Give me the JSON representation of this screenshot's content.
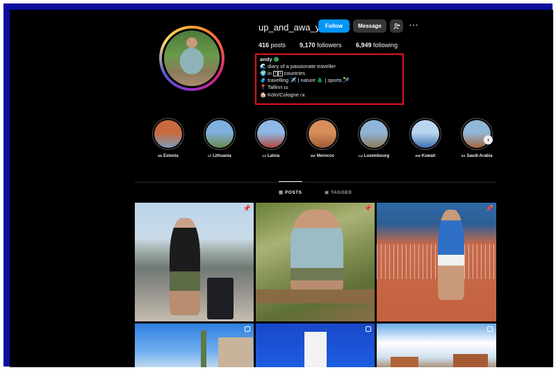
{
  "profile": {
    "username": "up_and_awa_y",
    "follow_label": "Follow",
    "message_label": "Message",
    "posts_count": "416",
    "posts_label": "posts",
    "followers_count": "9,170",
    "followers_label": "followers",
    "following_count": "6,949",
    "following_label": "following"
  },
  "bio": {
    "name": "andy",
    "line1": "diary of a passionate traveller",
    "line2_pre": "in",
    "line2_num": "7",
    "line2_num2": "3",
    "line2_post": "countries",
    "line3": "travelling ✈️ | nature 🌲 | sports 🎾",
    "line4": "Tallinn",
    "line4_flag": "EE",
    "line5": "Köln/Cologne",
    "line5_flag": "DE"
  },
  "highlights": [
    {
      "code": "EE",
      "label": "Estonia",
      "colors": [
        "#c76b3f",
        "#7e9ab8"
      ]
    },
    {
      "code": "LT",
      "label": "Lithuania",
      "colors": [
        "#7fb0de",
        "#6c8a4a"
      ]
    },
    {
      "code": "LV",
      "label": "Latvia",
      "colors": [
        "#8fb8e6",
        "#b0463a"
      ]
    },
    {
      "code": "MA",
      "label": "Morocco",
      "colors": [
        "#d88e5a",
        "#9d5a36"
      ]
    },
    {
      "code": "LU",
      "label": "Luxembourg",
      "colors": [
        "#8fb4d8",
        "#8a7a5a"
      ]
    },
    {
      "code": "KW",
      "label": "Kuwait",
      "colors": [
        "#b9d6f0",
        "#3b6fb0"
      ]
    },
    {
      "code": "SA",
      "label": "Saudi-Arabia",
      "colors": [
        "#8fb8d8",
        "#a8643a"
      ]
    }
  ],
  "tabs": {
    "posts": "POSTS",
    "tagged": "TAGGED"
  },
  "icons": {
    "add_user": "person-add-icon",
    "more": "more-dots-icon",
    "grid": "grid-icon",
    "tag": "tag-icon",
    "pin": "pin-icon",
    "multi": "multiple-photos-icon"
  },
  "colors": {
    "follow_blue": "#0095f6",
    "highlight_red": "#e3141b",
    "frame_blue": "#0c0f9e"
  }
}
